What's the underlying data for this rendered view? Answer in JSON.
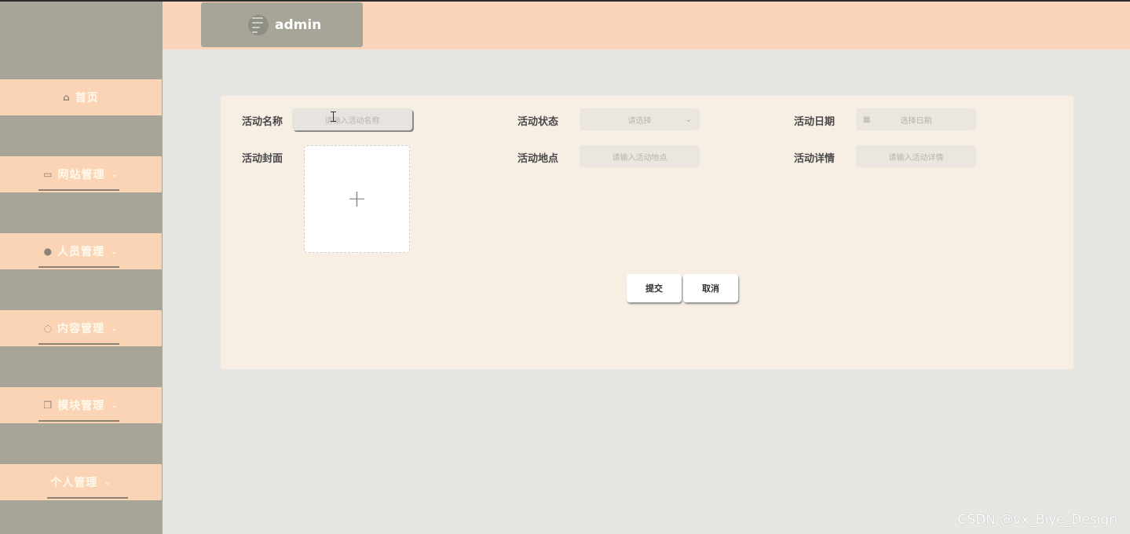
{
  "header": {
    "username": "admin"
  },
  "sidebar": {
    "items": [
      {
        "label": "首页",
        "icon": "home-icon"
      },
      {
        "label": "网站管理",
        "icon": "board-icon"
      },
      {
        "label": "人员管理",
        "icon": "user-icon"
      },
      {
        "label": "内容管理",
        "icon": "chat-icon"
      },
      {
        "label": "模块管理",
        "icon": "copy-icon"
      },
      {
        "label": "个人管理",
        "icon": ""
      }
    ]
  },
  "form": {
    "name_label": "活动名称",
    "name_placeholder": "请输入活动名称",
    "status_label": "活动状态",
    "status_placeholder": "请选择",
    "date_label": "活动日期",
    "date_placeholder": "选择日期",
    "cover_label": "活动封面",
    "cover_plus": "+",
    "location_label": "活动地点",
    "location_placeholder": "请输入活动地点",
    "detail_label": "活动详情",
    "detail_placeholder": "请输入活动详情",
    "submit_label": "提交",
    "cancel_label": "取消"
  },
  "watermark": "CSDN @vx_Biye_Design",
  "colors": {
    "sidebar_bg": "#a6a597",
    "menu_item_bg": "#fbd3b5",
    "header_bg": "#fbd5ba",
    "card_bg": "#f7eee4",
    "page_bg": "#e8e6e3"
  }
}
